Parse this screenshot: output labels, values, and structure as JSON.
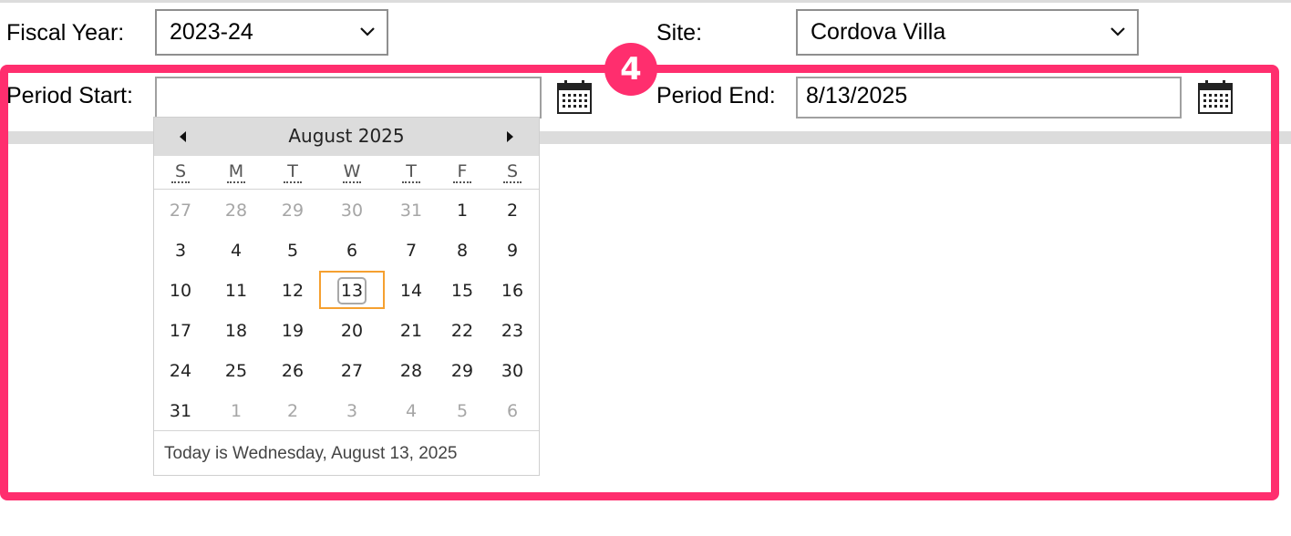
{
  "fiscal_year": {
    "label": "Fiscal Year:",
    "value": "2023-24"
  },
  "site": {
    "label": "Site:",
    "value": "Cordova Villa"
  },
  "period_start": {
    "label": "Period Start:",
    "value": ""
  },
  "period_end": {
    "label": "Period End:",
    "value": "8/13/2025"
  },
  "annotation": {
    "badge": "4",
    "color": "#ff2e6e"
  },
  "calendar": {
    "title": "August 2025",
    "weekdays": [
      "S",
      "M",
      "T",
      "W",
      "T",
      "F",
      "S"
    ],
    "weeks": [
      [
        "27",
        "28",
        "29",
        "30",
        "31",
        "1",
        "2"
      ],
      [
        "3",
        "4",
        "5",
        "6",
        "7",
        "8",
        "9"
      ],
      [
        "10",
        "11",
        "12",
        "13",
        "14",
        "15",
        "16"
      ],
      [
        "17",
        "18",
        "19",
        "20",
        "21",
        "22",
        "23"
      ],
      [
        "24",
        "25",
        "26",
        "27",
        "28",
        "29",
        "30"
      ],
      [
        "31",
        "1",
        "2",
        "3",
        "4",
        "5",
        "6"
      ]
    ],
    "other_month": [
      [
        true,
        true,
        true,
        true,
        true,
        false,
        false
      ],
      [
        false,
        false,
        false,
        false,
        false,
        false,
        false
      ],
      [
        false,
        false,
        false,
        false,
        false,
        false,
        false
      ],
      [
        false,
        false,
        false,
        false,
        false,
        false,
        false
      ],
      [
        false,
        false,
        false,
        false,
        false,
        false,
        false
      ],
      [
        false,
        true,
        true,
        true,
        true,
        true,
        true
      ]
    ],
    "today": "13",
    "footer": "Today is Wednesday, August 13, 2025"
  },
  "icons": {
    "prev": "triangle-left-icon",
    "next": "triangle-right-icon",
    "dropdown": "chevron-down-icon",
    "calendar": "calendar-icon"
  }
}
